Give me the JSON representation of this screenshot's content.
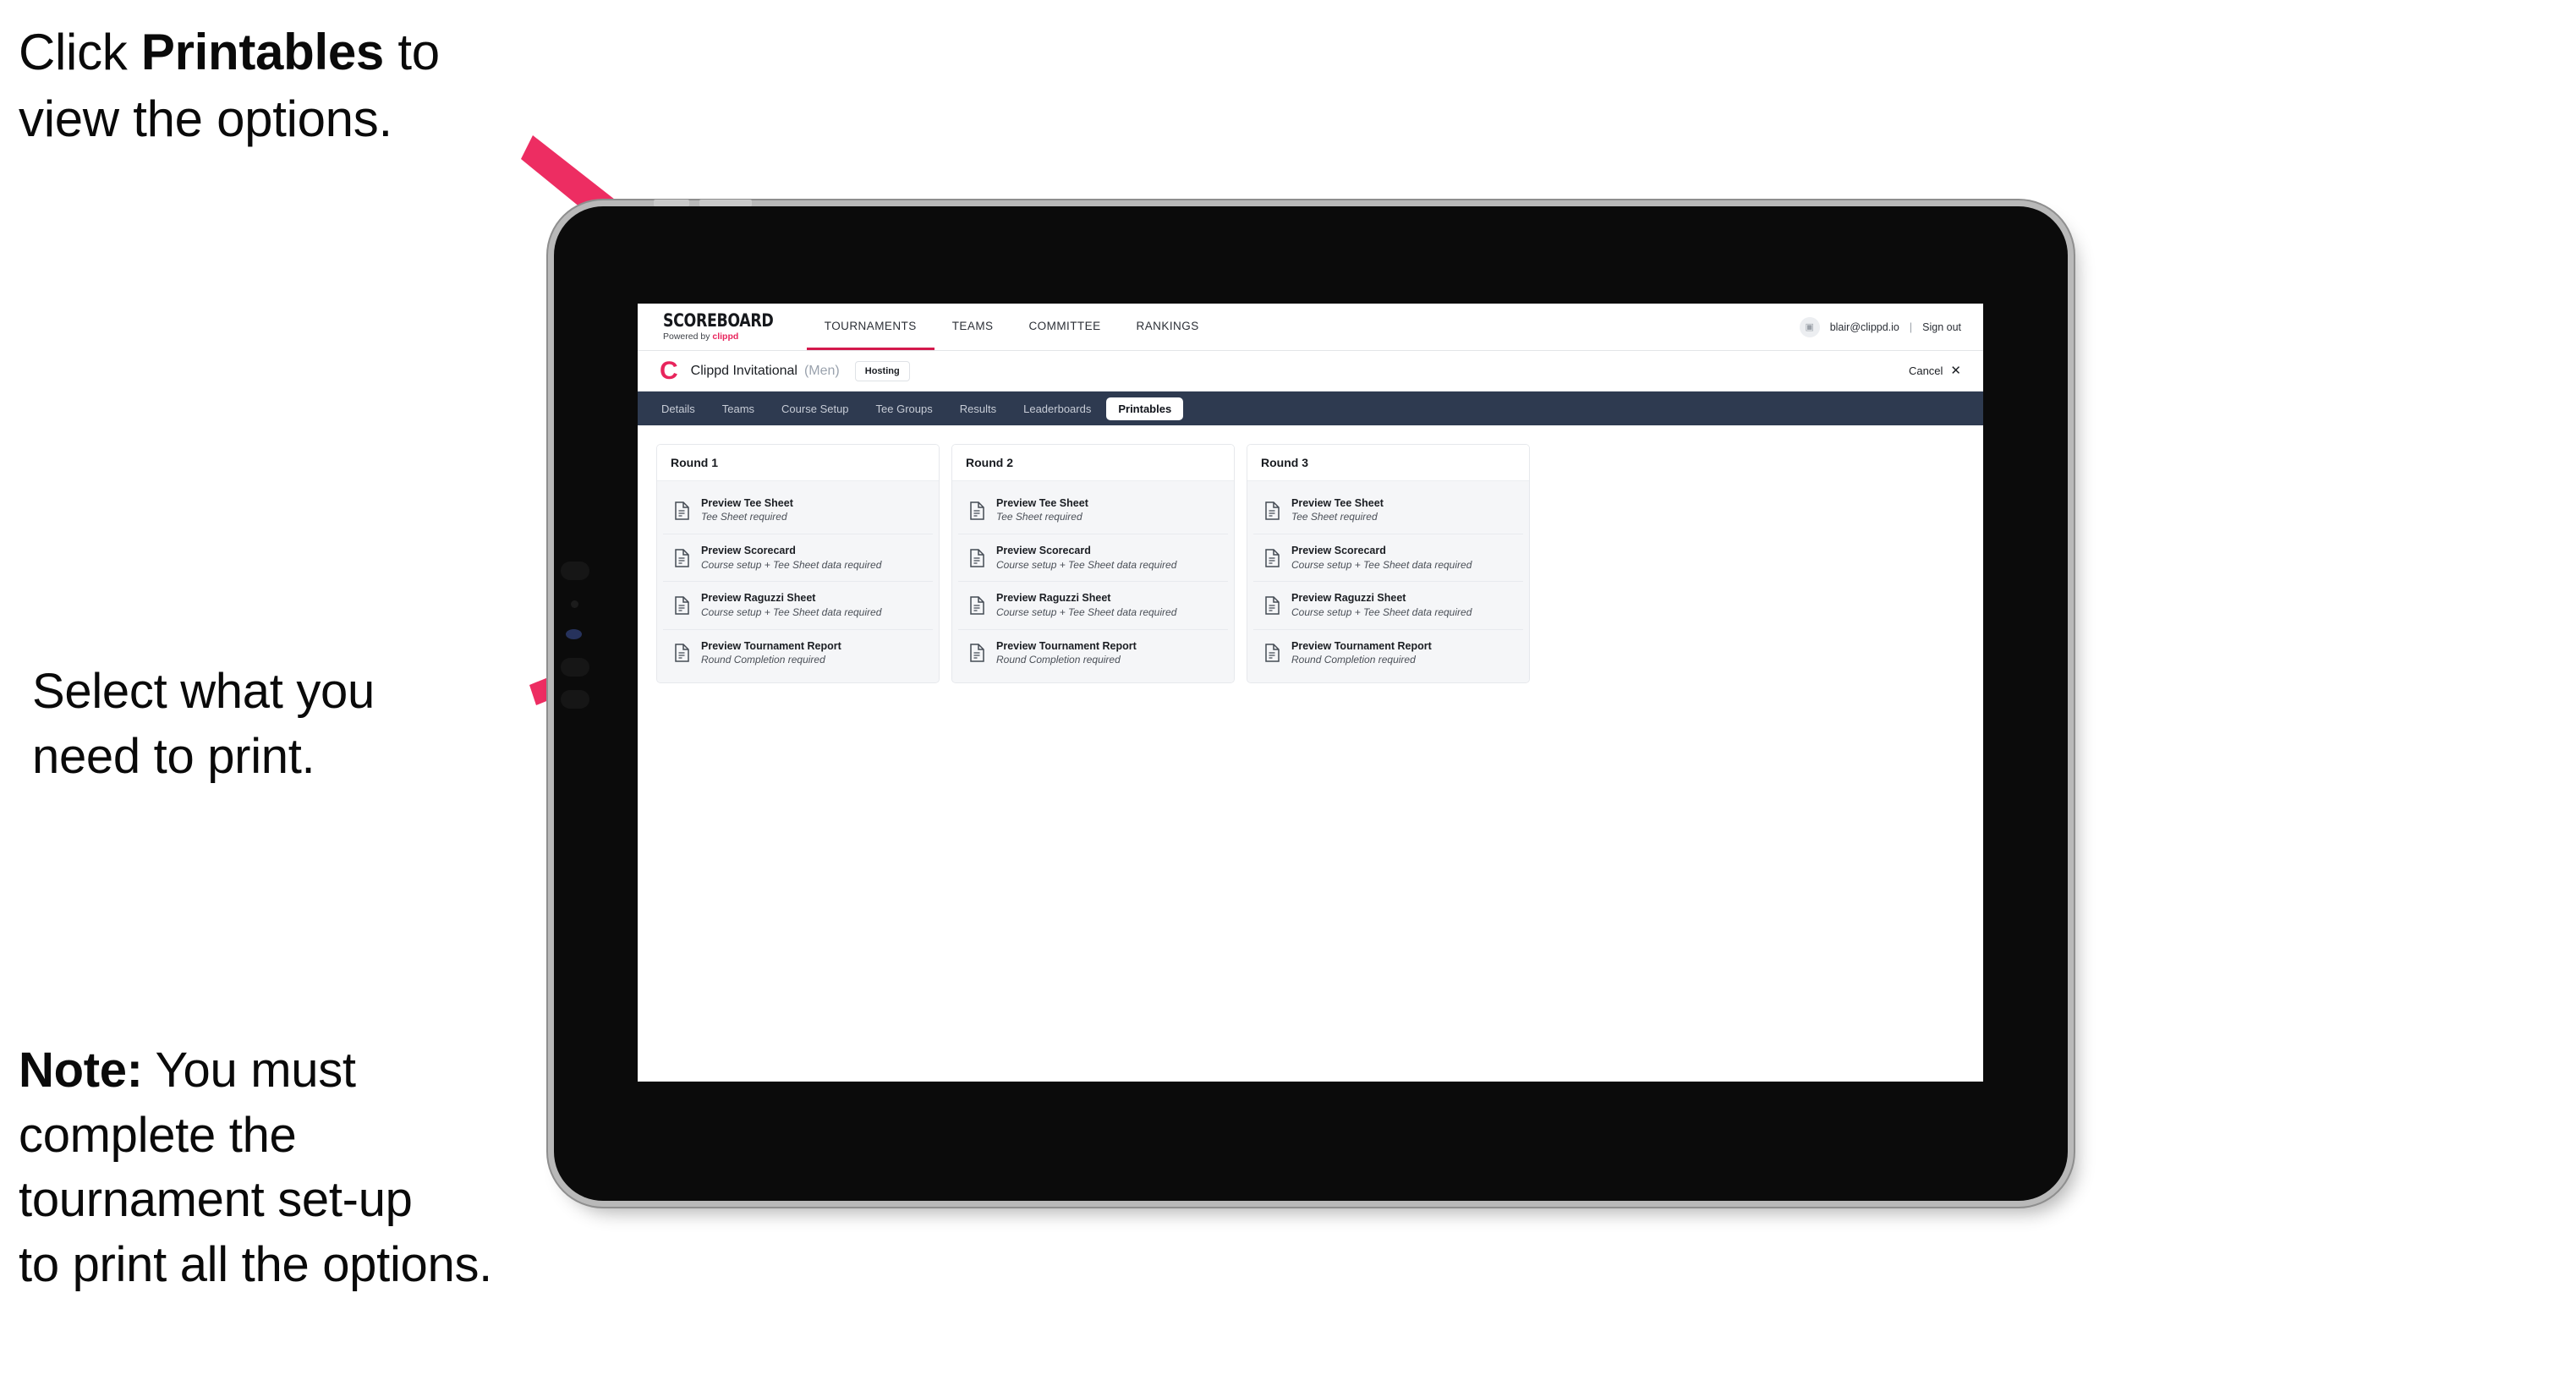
{
  "annotations": {
    "callout_1_prefix": "Click ",
    "callout_1_bold": "Printables",
    "callout_1_suffix": " to\nview the options.",
    "callout_2": "Select what you\n need to print.",
    "callout_3_bold": "Note:",
    "callout_3_rest": " You must\ncomplete the\ntournament set-up\nto print all the options.",
    "arrow_color": "#ED2D62"
  },
  "app": {
    "brand": {
      "title": "SCOREBOARD",
      "powered_prefix": "Powered by ",
      "powered_brand": "clippd"
    },
    "main_nav": [
      {
        "label": "TOURNAMENTS",
        "active": true
      },
      {
        "label": "TEAMS",
        "active": false
      },
      {
        "label": "COMMITTEE",
        "active": false
      },
      {
        "label": "RANKINGS",
        "active": false
      }
    ],
    "account": {
      "avatar_glyph": "▣",
      "email": "blair@clippd.io",
      "separator": "|",
      "sign_out": "Sign out"
    },
    "tournament": {
      "logo_letter": "C",
      "name": "Clippd Invitational",
      "gender": "(Men)",
      "status_badge": "Hosting",
      "cancel_label": "Cancel",
      "cancel_icon": "✕"
    },
    "tabs": [
      {
        "label": "Details",
        "active": false
      },
      {
        "label": "Teams",
        "active": false
      },
      {
        "label": "Course Setup",
        "active": false
      },
      {
        "label": "Tee Groups",
        "active": false
      },
      {
        "label": "Results",
        "active": false
      },
      {
        "label": "Leaderboards",
        "active": false
      },
      {
        "label": "Printables",
        "active": true
      }
    ],
    "rounds": [
      {
        "title": "Round 1",
        "items": [
          {
            "title": "Preview Tee Sheet",
            "requirement": "Tee Sheet required"
          },
          {
            "title": "Preview Scorecard",
            "requirement": "Course setup + Tee Sheet data required"
          },
          {
            "title": "Preview Raguzzi Sheet",
            "requirement": "Course setup + Tee Sheet data required"
          },
          {
            "title": "Preview Tournament Report",
            "requirement": "Round Completion required"
          }
        ]
      },
      {
        "title": "Round 2",
        "items": [
          {
            "title": "Preview Tee Sheet",
            "requirement": "Tee Sheet required"
          },
          {
            "title": "Preview Scorecard",
            "requirement": "Course setup + Tee Sheet data required"
          },
          {
            "title": "Preview Raguzzi Sheet",
            "requirement": "Course setup + Tee Sheet data required"
          },
          {
            "title": "Preview Tournament Report",
            "requirement": "Round Completion required"
          }
        ]
      },
      {
        "title": "Round 3",
        "items": [
          {
            "title": "Preview Tee Sheet",
            "requirement": "Tee Sheet required"
          },
          {
            "title": "Preview Scorecard",
            "requirement": "Course setup + Tee Sheet data required"
          },
          {
            "title": "Preview Raguzzi Sheet",
            "requirement": "Course setup + Tee Sheet data required"
          },
          {
            "title": "Preview Tournament Report",
            "requirement": "Round Completion required"
          }
        ]
      }
    ],
    "colors": {
      "brand_pink": "#E8245C",
      "tabstrip_navy": "#2E3A50",
      "nav_underline": "#D4184C"
    }
  }
}
